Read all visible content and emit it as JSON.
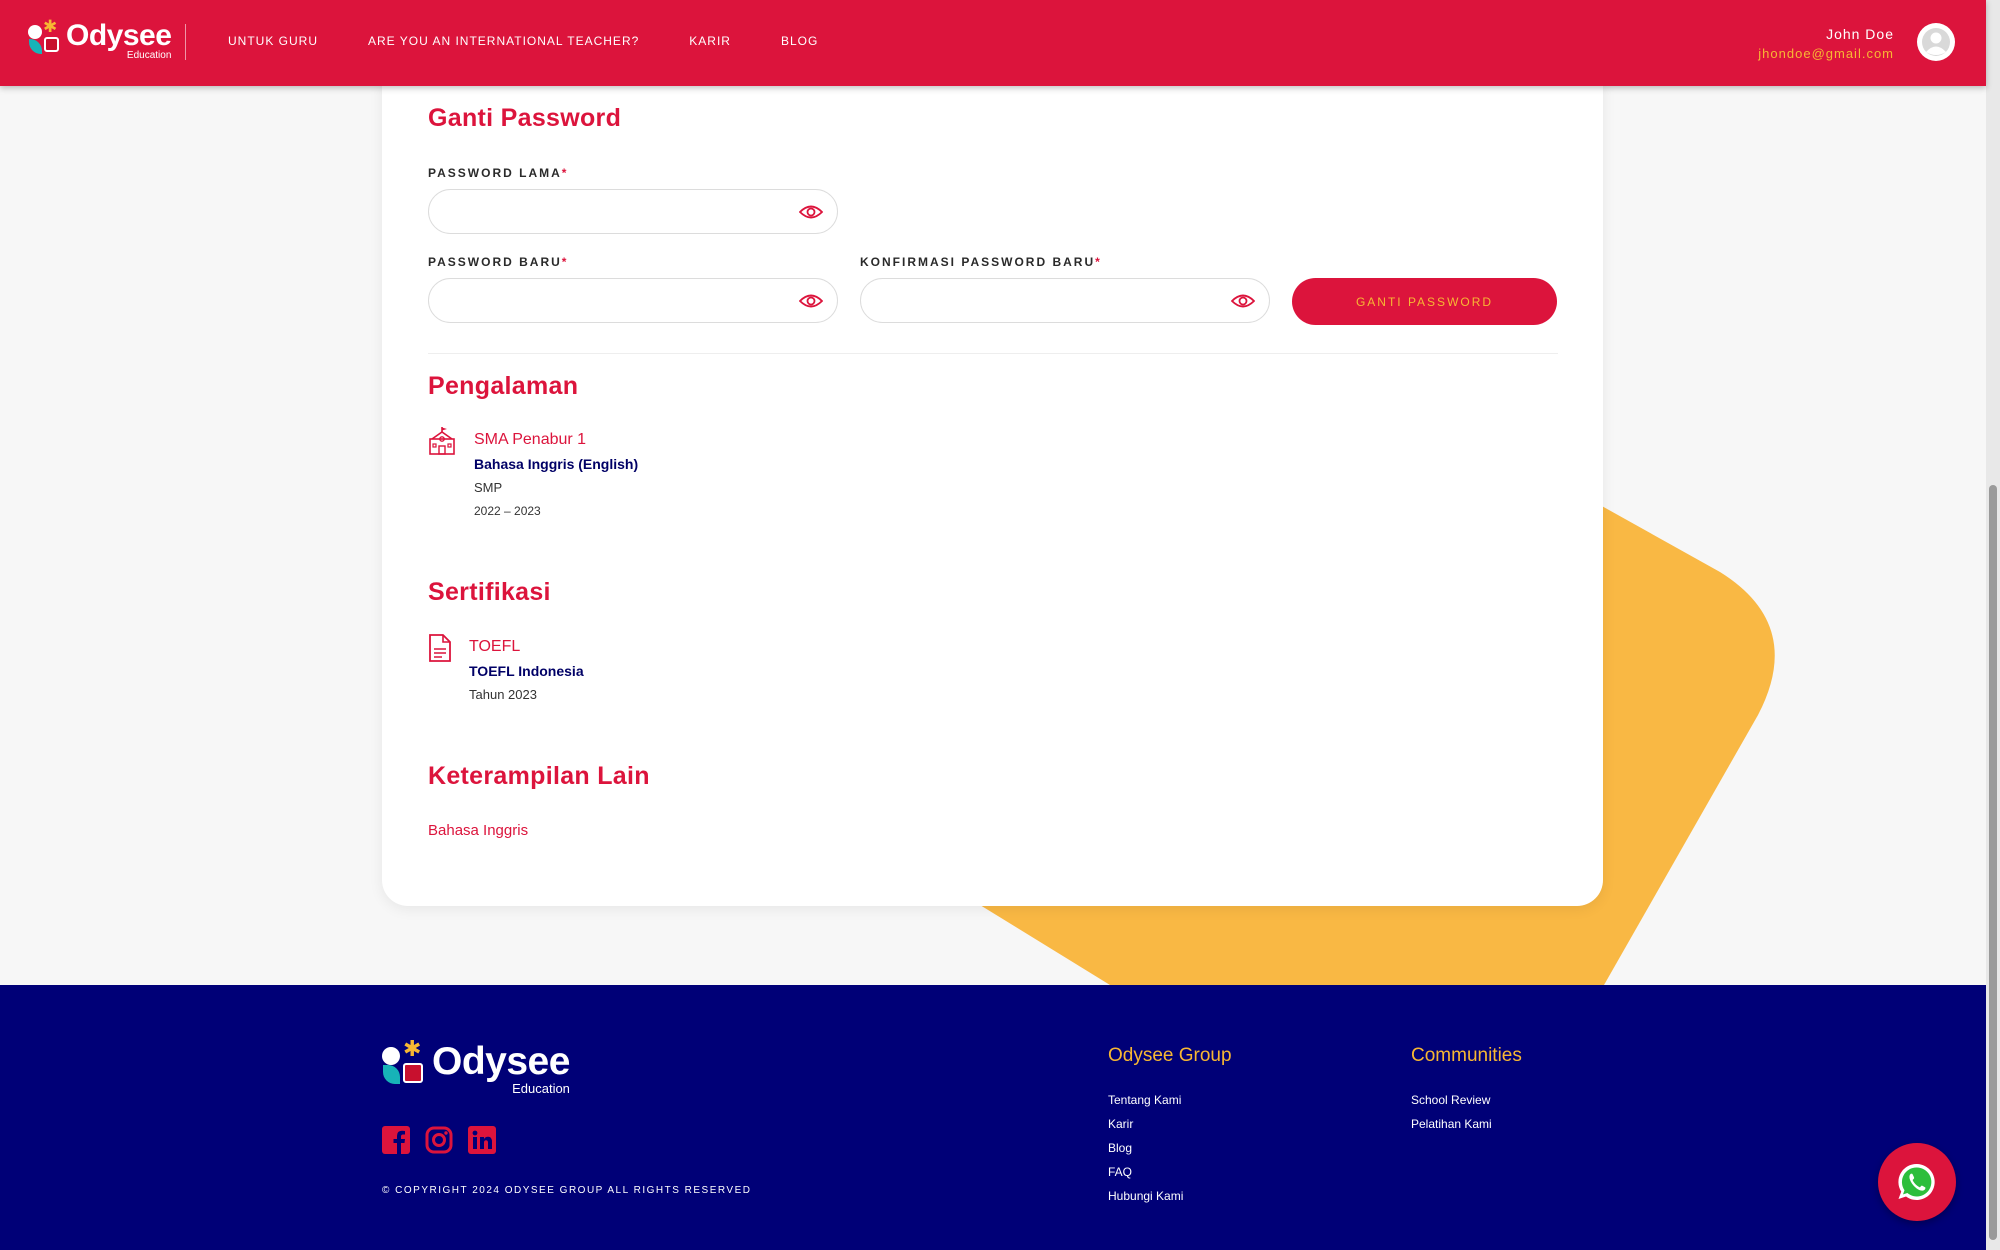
{
  "brand": {
    "name": "Odysee",
    "sub": "Education"
  },
  "nav": {
    "items": [
      {
        "label": "UNTUK GURU"
      },
      {
        "label": "ARE YOU AN INTERNATIONAL TEACHER?"
      },
      {
        "label": "KARIR"
      },
      {
        "label": "BLOG"
      }
    ]
  },
  "user": {
    "name": "John Doe",
    "email": "jhondoe@gmail.com"
  },
  "password_section": {
    "title": "Ganti Password",
    "old_label": "PASSWORD LAMA",
    "new_label": "PASSWORD BARU",
    "confirm_label": "KONFIRMASI PASSWORD BARU",
    "required_mark": "*",
    "old_value": "",
    "new_value": "",
    "confirm_value": "",
    "button_label": "GANTI PASSWORD"
  },
  "experience": {
    "title": "Pengalaman",
    "items": [
      {
        "school": "SMA Penabur 1",
        "subject": "Bahasa Inggris (English)",
        "level": "SMP",
        "years": "2022 – 2023"
      }
    ]
  },
  "certification": {
    "title": "Sertifikasi",
    "items": [
      {
        "name": "TOEFL",
        "org": "TOEFL Indonesia",
        "year": "Tahun 2023"
      }
    ]
  },
  "skills": {
    "title": "Keterampilan Lain",
    "items": [
      {
        "label": "Bahasa Inggris"
      }
    ]
  },
  "footer": {
    "copyright": "© COPYRIGHT 2024 ODYSEE GROUP ALL RIGHTS RESERVED",
    "group": {
      "title": "Odysee Group",
      "links": [
        {
          "label": "Tentang Kami"
        },
        {
          "label": "Karir"
        },
        {
          "label": "Blog"
        },
        {
          "label": "FAQ"
        },
        {
          "label": "Hubungi Kami"
        }
      ]
    },
    "communities": {
      "title": "Communities",
      "links": [
        {
          "label": "School Review"
        },
        {
          "label": "Pelatihan Kami"
        }
      ]
    },
    "social": [
      "facebook-icon",
      "instagram-icon",
      "linkedin-icon"
    ]
  },
  "colors": {
    "primary": "#dc143c",
    "accent": "#f7b733",
    "navy": "#000077",
    "deco_yellow": "#f9b844"
  }
}
